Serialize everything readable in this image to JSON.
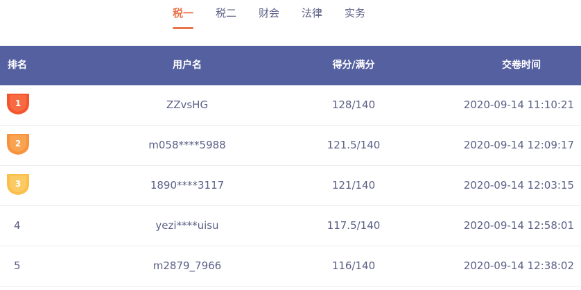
{
  "tabs": [
    {
      "label": "税一",
      "active": true
    },
    {
      "label": "税二",
      "active": false
    },
    {
      "label": "财会",
      "active": false
    },
    {
      "label": "法律",
      "active": false
    },
    {
      "label": "实务",
      "active": false
    }
  ],
  "colors": {
    "accent": "#e8744a",
    "header_bg": "#5560a0",
    "text": "#5b5f86",
    "medal_1": "#f4552e",
    "medal_2": "#f7923e",
    "medal_3": "#fbbf4c"
  },
  "table": {
    "headers": {
      "rank": "排名",
      "user": "用户名",
      "score": "得分/满分",
      "time": "交卷时间"
    },
    "rows": [
      {
        "rank": "1",
        "medal": "medal-icon",
        "user": "ZZvsHG",
        "score": "128/140",
        "time": "2020-09-14 11:10:21"
      },
      {
        "rank": "2",
        "medal": "medal-icon",
        "user": "m058****5988",
        "score": "121.5/140",
        "time": "2020-09-14 12:09:17"
      },
      {
        "rank": "3",
        "medal": "medal-icon",
        "user": "1890****3117",
        "score": "121/140",
        "time": "2020-09-14 12:03:15"
      },
      {
        "rank": "4",
        "user": "yezi****uisu",
        "score": "117.5/140",
        "time": "2020-09-14 12:58:01"
      },
      {
        "rank": "5",
        "user": "m2879_7966",
        "score": "116/140",
        "time": "2020-09-14 12:38:02"
      }
    ]
  }
}
